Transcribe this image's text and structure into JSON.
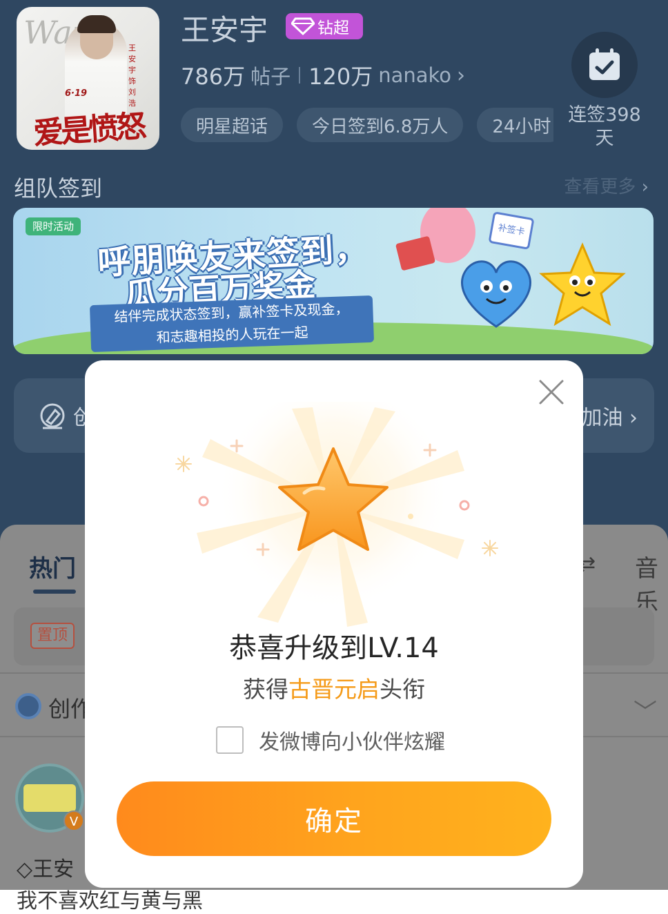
{
  "header": {
    "name": "王安宇",
    "badge": "钻超",
    "posts_count": "786万",
    "posts_label": "帖子",
    "fans_count": "120万",
    "fans_label": "nanako",
    "chevron": "›",
    "chips": [
      "明星超话",
      "今日签到6.8万人",
      "24小时"
    ],
    "signin_label": "连签398天"
  },
  "cover": {
    "date_text": "6·19",
    "big_text": "爱是愤怒",
    "side_text": "王安宇 饰 刘浩"
  },
  "team": {
    "title": "组队签到",
    "more": "查看更多"
  },
  "banner": {
    "tag": "限时活动",
    "headline_1": "呼朋唤友来签到，",
    "headline_2": "瓜分百万奖金",
    "sub_1": "结伴完成状态签到，赢补签卡及现金，",
    "sub_2": "和志趣相投的人玩在一起",
    "card_label": "补签卡"
  },
  "create_row": {
    "left_text": "创",
    "right_text": "加油"
  },
  "feed": {
    "tab_hot": "热门",
    "tab_right": "音乐",
    "pinned_tag": "置顶",
    "creator_text": "创作",
    "user_name": "王安",
    "verified": "V",
    "last_line": "我不喜欢红与黄与黑"
  },
  "modal": {
    "title": "恭喜升级到LV.14",
    "sub_prefix": "获得",
    "sub_highlight": "古晋元启",
    "sub_suffix": "头衔",
    "share_label": "发微博向小伙伴炫耀",
    "share_checked": false,
    "confirm_label": "确定"
  },
  "colors": {
    "accent": "#f59a17",
    "button_start": "#ff8a1c",
    "button_end": "#ffb21d",
    "badge_purple": "#c254d8",
    "header_bg": "#2f4761"
  }
}
